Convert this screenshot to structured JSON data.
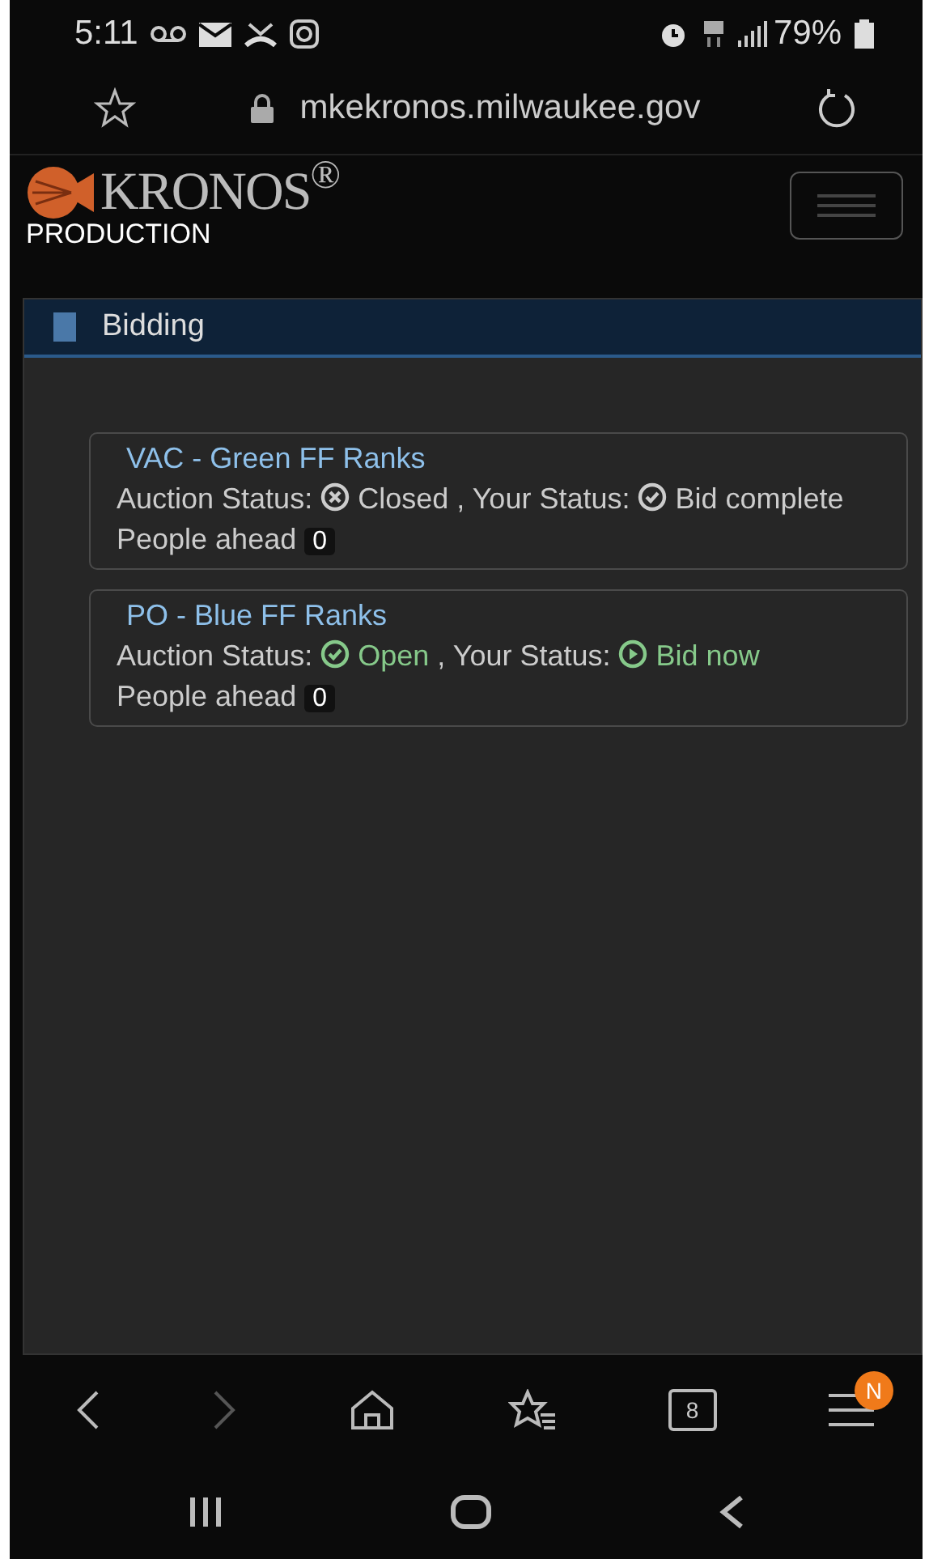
{
  "status_bar": {
    "time": "5:11",
    "battery": "79%"
  },
  "url_bar": {
    "url": "mkekronos.milwaukee.gov"
  },
  "app_header": {
    "logo": "KRONOS$^{®}$",
    "environment": "PRODUCTION"
  },
  "panel": {
    "title": "Bidding"
  },
  "auctions": [
    {
      "title": "VAC - Green FF Ranks",
      "auction_label": "Auction Status:",
      "auction_state": "Closed",
      "auction_open": false,
      "your_label": ", Your Status:",
      "your_state": "Bid complete",
      "can_bid": false,
      "people_label": "People ahead",
      "people_count": "0"
    },
    {
      "title": "PO - Blue FF Ranks",
      "auction_label": "Auction Status:",
      "auction_state": "Open",
      "auction_open": true,
      "your_label": ", Your Status:",
      "your_state": "Bid now",
      "can_bid": true,
      "people_label": "People ahead",
      "people_count": "0"
    }
  ],
  "browser_nav": {
    "forward_disabled": true,
    "tabs_count": "8",
    "menu_badge": "N"
  }
}
